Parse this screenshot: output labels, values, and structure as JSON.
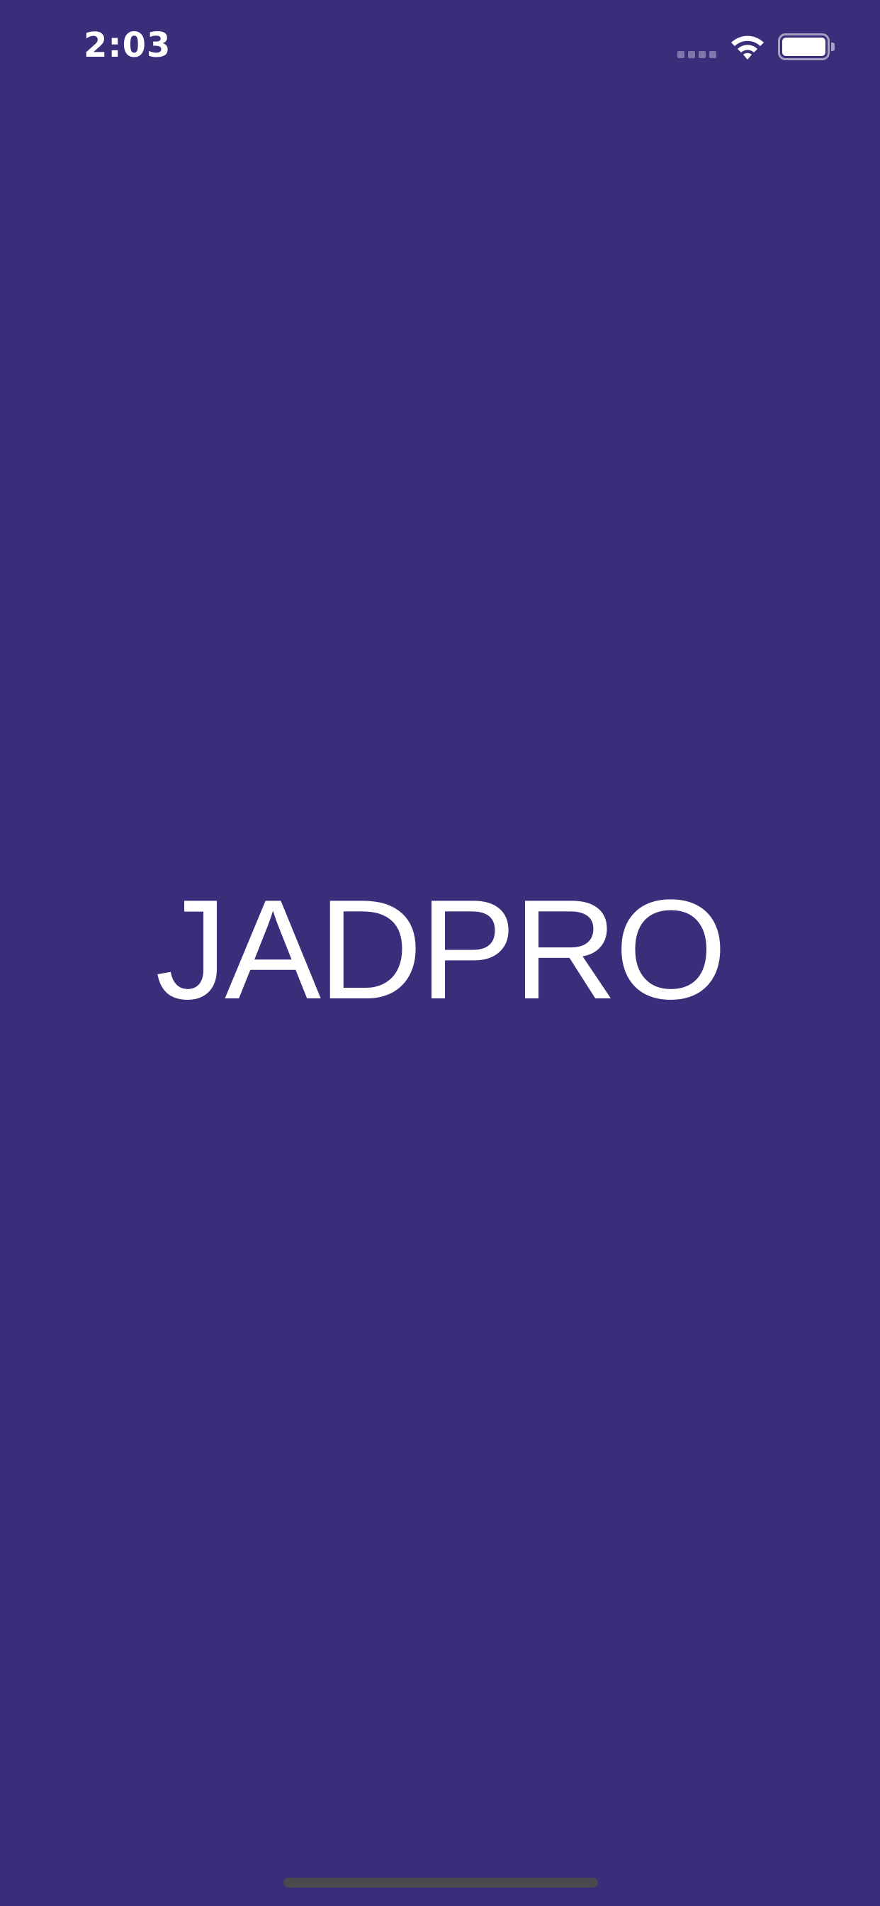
{
  "status_bar": {
    "time": "2:03",
    "icons": [
      "signal-icon",
      "wifi-icon",
      "battery-icon"
    ]
  },
  "splash": {
    "logo_text": "JADPRO"
  },
  "colors": {
    "background": "#3a2e7a",
    "text": "#ffffff",
    "home_indicator": "#4a4a4e"
  }
}
